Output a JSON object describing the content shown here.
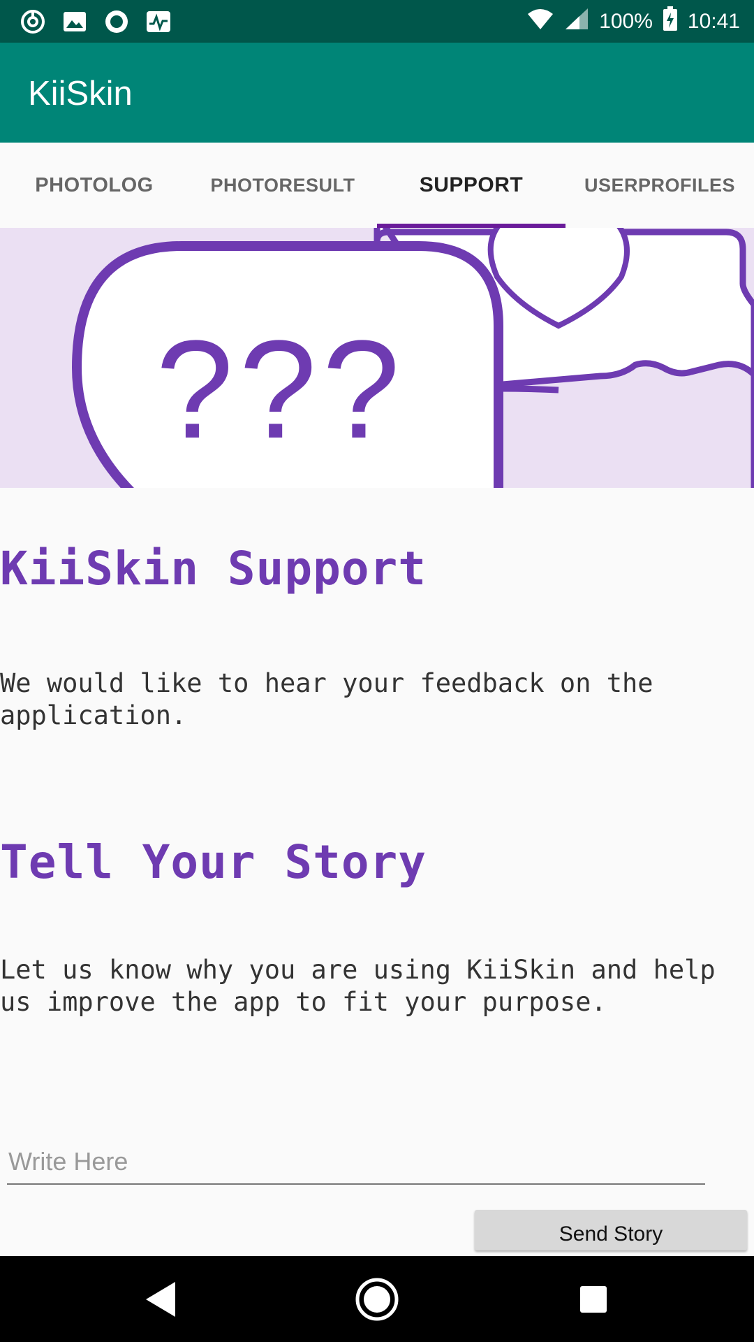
{
  "status_bar": {
    "left_icons": [
      "vpn-spiral-icon",
      "image-icon",
      "record-icon",
      "activity-icon"
    ],
    "battery": "100%",
    "time": "10:41"
  },
  "app": {
    "title": "KiiSkin",
    "accent_color": "#008577",
    "status_color": "#00574b",
    "brand_purple": "#6e3bb1"
  },
  "tabs": [
    {
      "label": "PHOTOLOG"
    },
    {
      "label": "PHOTORESULT"
    },
    {
      "label": "SUPPORT",
      "selected": true
    },
    {
      "label": "USERPROFILES"
    }
  ],
  "banner": {
    "text": "???"
  },
  "support": {
    "title": "KiiSkin Support",
    "line1": "We would like to hear your feedback on the",
    "line2": "application."
  },
  "story": {
    "title": "Tell Your Story",
    "line1": "Let us know why you are using KiiSkin and help",
    "line2": "us improve the app to fit your purpose.",
    "input_placeholder": "Write Here",
    "input_value": "",
    "send_label": "Send Story"
  }
}
